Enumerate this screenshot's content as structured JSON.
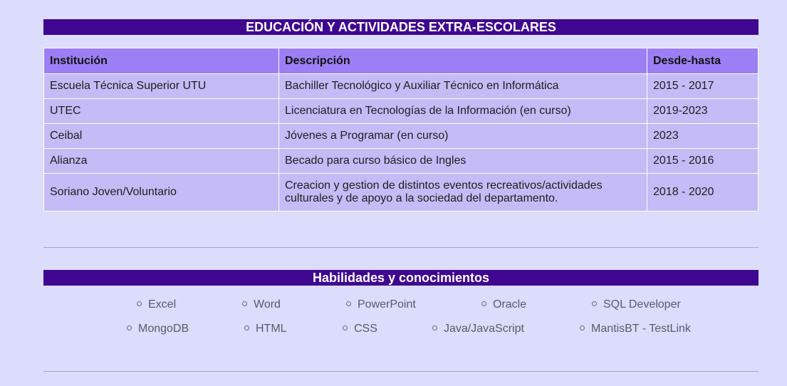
{
  "education": {
    "title": "EDUCACIÓN Y ACTIVIDADES EXTRA-ESCOLARES",
    "headers": [
      "Institución",
      "Descripción",
      "Desde-hasta"
    ],
    "rows": [
      [
        "Escuela Técnica Superior UTU",
        "Bachiller Tecnológico y Auxiliar Técnico en Informática",
        "2015 - 2017"
      ],
      [
        "UTEC",
        "Licenciatura en Tecnologías de la Información (en curso)",
        "2019-2023"
      ],
      [
        "Ceibal",
        "Jóvenes a Programar (en curso)",
        "2023"
      ],
      [
        "Alianza",
        "Becado para curso básico de Ingles",
        "2015 - 2016"
      ],
      [
        "Soriano Joven/Voluntario",
        "Creacion y gestion de distintos eventos recreativos/actividades culturales y de apoyo a la sociedad del departamento.",
        "2018 - 2020"
      ]
    ]
  },
  "skills": {
    "title": "Habilidades y conocimientos",
    "items": [
      "Excel",
      "Word",
      "PowerPoint",
      "Oracle",
      "SQL Developer",
      "MongoDB",
      "HTML",
      "CSS",
      "Java/JavaScript",
      "MantisBT - TestLink"
    ]
  },
  "colors": {
    "page_bg": "#dcdcfd",
    "section_bar": "#3f068f",
    "table_header": "#9d7ff5",
    "table_cell": "#c5bbf6"
  }
}
